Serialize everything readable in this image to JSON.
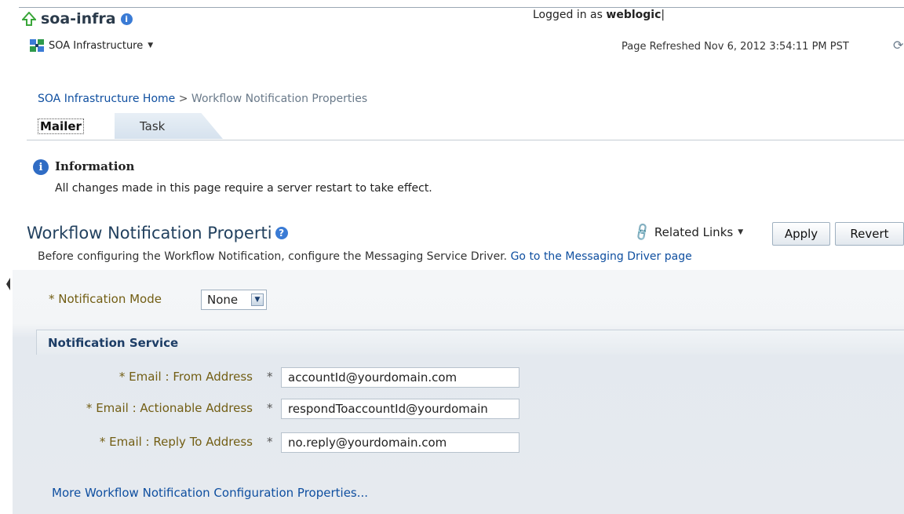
{
  "header": {
    "app_title": "soa-infra",
    "target_menu_label": "SOA Infrastructure",
    "logged_in_prefix": "Logged in as ",
    "logged_in_user": "weblogic",
    "page_refreshed": "Page Refreshed Nov 6, 2012 3:54:11 PM PST"
  },
  "breadcrumb": {
    "home": "SOA Infrastructure Home",
    "separator": ">",
    "current": "Workflow Notification Properties"
  },
  "tabs": [
    {
      "label": "Mailer",
      "selected": true
    },
    {
      "label": "Task",
      "selected": false
    }
  ],
  "info": {
    "title": "Information",
    "message": "All changes made in this page require a server restart to take effect."
  },
  "page": {
    "heading": "Workflow Notification Properti",
    "related_links": "Related Links",
    "apply": "Apply",
    "revert": "Revert",
    "description": "Before configuring the Workflow Notification, configure the Messaging Service Driver.",
    "driver_link": "Go to the Messaging Driver page"
  },
  "form": {
    "mode_label": "* Notification Mode",
    "mode_value": "None",
    "section_title": "Notification Service",
    "required_mark": "*",
    "fields": [
      {
        "label": "* Email : From Address",
        "value": "accountId@yourdomain.com"
      },
      {
        "label": "* Email : Actionable Address",
        "value": "respondToaccountId@yourdomain"
      },
      {
        "label": "* Email : Reply To Address",
        "value": "no.reply@yourdomain.com"
      }
    ],
    "more_link": "More Workflow Notification Configuration Properties..."
  },
  "colors": {
    "link": "#0f4fa0",
    "label": "#725e14",
    "heading": "#22415f",
    "info": "#2f6cc4"
  }
}
